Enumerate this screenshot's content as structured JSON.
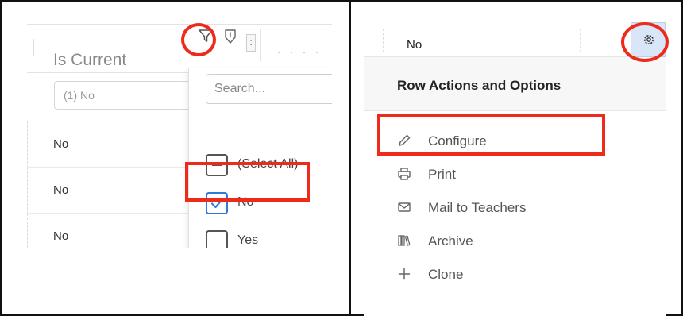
{
  "grid": {
    "column_title": "Is Current",
    "filter_count": "1",
    "menu_glyph": ":",
    "filter_value": "(1) No",
    "rows": [
      "No",
      "No",
      "No"
    ]
  },
  "filter_dropdown": {
    "search_placeholder": "Search...",
    "options": [
      {
        "label": "(Select All)",
        "state": "indeterminate"
      },
      {
        "label": "No",
        "state": "checked"
      },
      {
        "label": "Yes",
        "state": "unchecked"
      }
    ]
  },
  "row_actions": {
    "row_value": "No",
    "title": "Row Actions and Options",
    "items": [
      {
        "label": "Configure",
        "icon": "pencil-icon"
      },
      {
        "label": "Print",
        "icon": "printer-icon"
      },
      {
        "label": "Mail to Teachers",
        "icon": "mail-icon"
      },
      {
        "label": "Archive",
        "icon": "archive-icon"
      },
      {
        "label": "Clone",
        "icon": "plus-icon"
      }
    ]
  },
  "colors": {
    "highlight": "#ee2a1b",
    "checkbox_checked": "#2f7bd9",
    "gear_button_bg": "#d9e6f7"
  }
}
